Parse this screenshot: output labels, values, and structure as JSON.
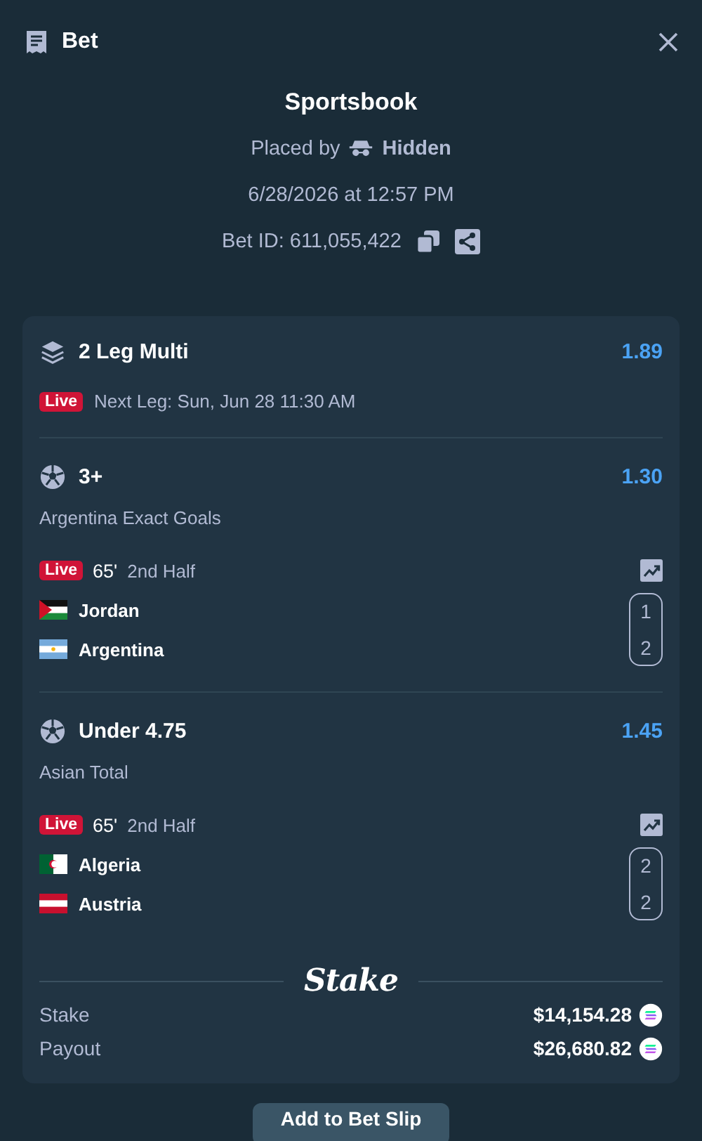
{
  "header": {
    "title": "Bet"
  },
  "summary": {
    "title": "Sportsbook",
    "placed_by_label": "Placed by",
    "placed_by_user": "Hidden",
    "datetime": "6/28/2026 at 12:57 PM",
    "bet_id": "Bet ID: 611,055,422"
  },
  "bet": {
    "title": "2 Leg Multi",
    "odds": "1.89",
    "live_badge": "Live",
    "next_leg": "Next Leg: Sun, Jun 28 11:30 AM"
  },
  "legs": [
    {
      "selection": "3+",
      "odds": "1.30",
      "market": "Argentina Exact Goals",
      "live_badge": "Live",
      "minute": "65'",
      "period": "2nd Half",
      "teams": [
        {
          "name": "Jordan",
          "kind": "jordan",
          "score": "1"
        },
        {
          "name": "Argentina",
          "kind": "argentina",
          "score": "2"
        }
      ]
    },
    {
      "selection": "Under 4.75",
      "odds": "1.45",
      "market": "Asian Total",
      "live_badge": "Live",
      "minute": "65'",
      "period": "2nd Half",
      "teams": [
        {
          "name": "Algeria",
          "kind": "algeria",
          "score": "2"
        },
        {
          "name": "Austria",
          "kind": "austria",
          "score": "2"
        }
      ]
    }
  ],
  "brand": "Stake",
  "totals": [
    {
      "label": "Stake",
      "amount": "$14,154.28"
    },
    {
      "label": "Payout",
      "amount": "$26,680.82"
    }
  ],
  "button": "Add to Bet Slip"
}
